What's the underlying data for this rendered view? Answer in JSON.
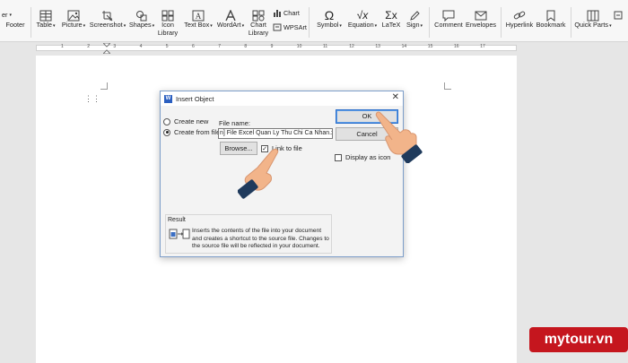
{
  "ribbon": {
    "partial_first_label": "er",
    "footer": "Footer",
    "table": "Table",
    "picture": "Picture",
    "screenshot": "Screenshot",
    "shapes": "Shapes",
    "icon_library": [
      "Icon",
      "Library"
    ],
    "text_box": "Text Box",
    "wordart": "WordArt",
    "chart_library": [
      "Chart",
      "Library"
    ],
    "chart": "Chart",
    "wpsart": "WPSArt",
    "symbol": "Symbol",
    "equation": "Equation",
    "latex": "LaTeX",
    "sign": "Sign",
    "comment": "Comment",
    "envelopes": "Envelopes",
    "hyperlink": "Hyperlink",
    "bookmark": "Bookmark",
    "quick_parts": "Quick Parts"
  },
  "ruler": {
    "ticks": [
      "1",
      "2",
      "3",
      "4",
      "5",
      "6",
      "7",
      "8",
      "9",
      "10",
      "11",
      "12",
      "13",
      "14",
      "15",
      "16",
      "17"
    ]
  },
  "dialog": {
    "title": "Insert Object",
    "create_new": "Create new",
    "create_from_file": "Create from file",
    "selected_option": "create_from_file",
    "file_name_label": "File name:",
    "file_name_value": "n] File Excel Quan Ly Thu Chi Ca Nhan.xlsx",
    "browse": "Browse...",
    "link_to_file": "Link to file",
    "link_to_file_checked": true,
    "display_as_icon": "Display as icon",
    "display_as_icon_checked": false,
    "ok": "OK",
    "cancel": "Cancel",
    "result_label": "Result",
    "result_text": "Inserts the contents of the file into your document and creates a shortcut to the source file. Changes to the source file will be reflected in your document."
  },
  "watermark": "mytour.vn",
  "colors": {
    "accent": "#2a6ecb",
    "hand_skin": "#f2b48a",
    "hand_cuff": "#1f3a5c",
    "watermark_bg": "#c5161e"
  }
}
